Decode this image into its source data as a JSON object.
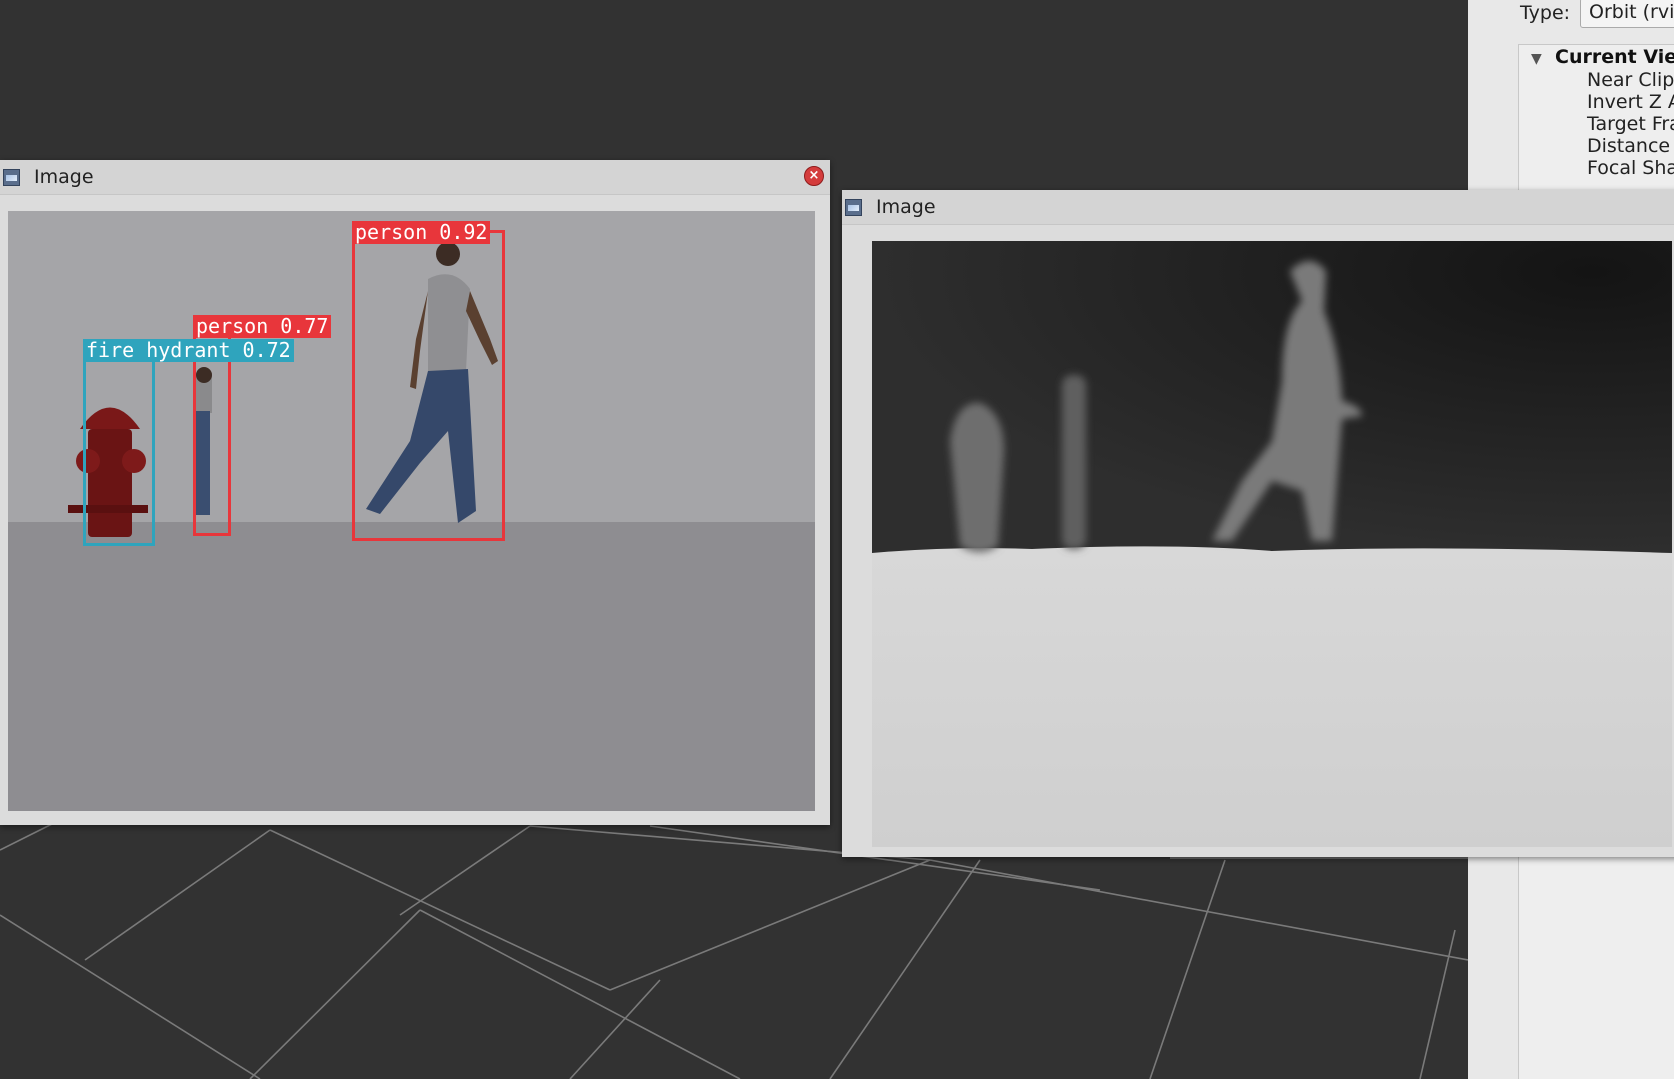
{
  "views_panel": {
    "type_label": "Type:",
    "type_value": "Orbit (rvi",
    "tree": {
      "group_title": "Current Vie",
      "rows": [
        "Near Clip",
        "Invert Z A",
        "Target Fra",
        "Distance",
        "Focal Sha"
      ]
    }
  },
  "detection_window": {
    "title": "Image",
    "detections": [
      {
        "label": "person 0.92",
        "class": "person",
        "confidence": 0.92,
        "color": "#e8363b"
      },
      {
        "label": "person 0.77",
        "class": "person",
        "confidence": 0.77,
        "color": "#e8363b"
      },
      {
        "label": "fire hydrant 0.72",
        "class": "fire hydrant",
        "confidence": 0.72,
        "color": "#2fa4bd"
      }
    ]
  },
  "depth_window": {
    "title": "Image"
  }
}
